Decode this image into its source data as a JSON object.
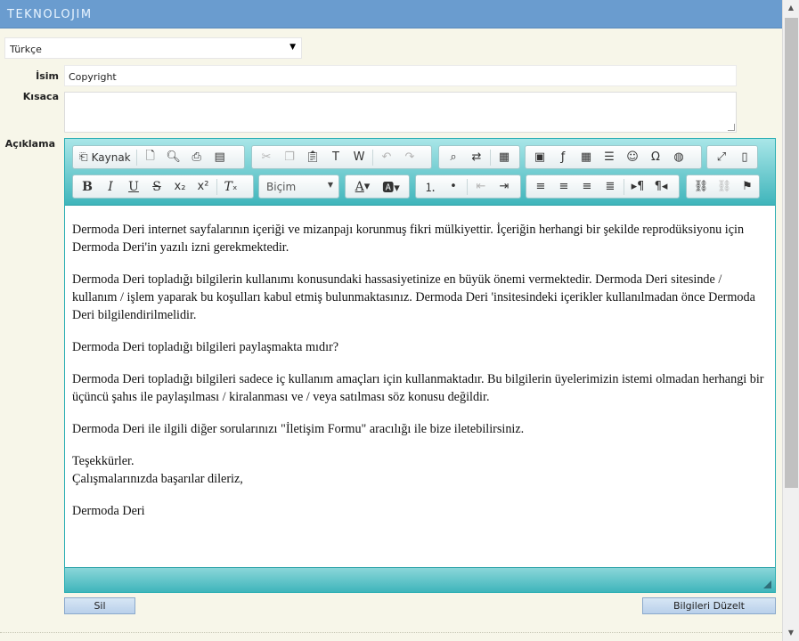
{
  "app": {
    "logo": "TEKNOLOJIM"
  },
  "language": {
    "selected": "Türkçe"
  },
  "fields": {
    "name_label": "İsim",
    "name_value": "Copyright",
    "short_label": "Kısaca",
    "desc_label": "Açıklama"
  },
  "toolbar": {
    "source_label": "Kaynak",
    "format_label": "Biçim"
  },
  "content": {
    "paragraphs": [
      "Dermoda Deri internet sayfalarının içeriği ve mizanpajı korunmuş fikri mülkiyettir. İçeriğin herhangi bir şekilde reprodüksiyonu için Dermoda Deri'in yazılı izni gerekmektedir.",
      "Dermoda Deri topladığı bilgilerin kullanımı konusundaki hassasiyetinize en büyük önemi vermektedir. Dermoda Deri sitesinde / kullanım / işlem yaparak bu koşulları kabul etmiş bulunmaktasınız. Dermoda Deri 'insitesindeki içerikler kullanılmadan önce Dermoda Deri bilgilendirilmelidir.",
      "Dermoda Deri topladığı bilgileri paylaşmakta mıdır?",
      "Dermoda Deri topladığı bilgileri sadece iç kullanım amaçları için kullanmaktadır. Bu bilgilerin üyelerimizin istemi olmadan herhangi bir üçüncü şahıs ile paylaşılması / kiralanması ve / veya satılması söz konusu değildir.",
      "Dermoda Deri ile ilgili diğer sorularınızı \"İletişim Formu\" aracılığı ile bize iletebilirsiniz.",
      "Dermoda Deri"
    ],
    "thanks_line1": "Teşekkürler.",
    "thanks_line2": "Çalışmalarınızda başarılar dileriz,"
  },
  "actions": {
    "delete_label": "Sil",
    "update_label": "Bilgileri Düzelt"
  }
}
